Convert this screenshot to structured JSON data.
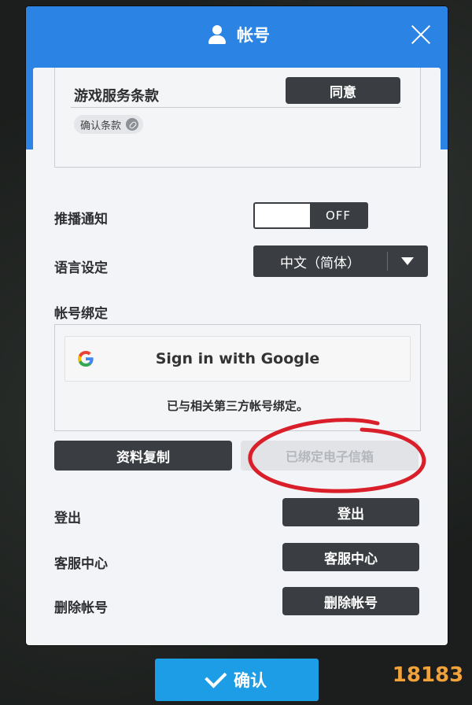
{
  "dialog": {
    "title": "帐号",
    "terms": {
      "label": "游戏服务条款",
      "agree_button": "同意",
      "confirm_link": "确认条款"
    },
    "push": {
      "label": "推播通知",
      "toggle_state": "OFF"
    },
    "language": {
      "label": "语言设定",
      "selected": "中文（简体）"
    },
    "binding": {
      "label": "帐号绑定",
      "google_button": "Sign in with Google",
      "note": "已与相关第三方帐号绑定。"
    },
    "actions": {
      "copy_data": "资料复制",
      "email_bound": "已绑定电子信箱"
    },
    "logout": {
      "label": "登出",
      "button": "登出"
    },
    "support": {
      "label": "客服中心",
      "button": "客服中心"
    },
    "delete": {
      "label": "删除帐号",
      "button": "删除帐号"
    }
  },
  "ok_button": "确认",
  "watermark": "18183",
  "colors": {
    "header_blue": "#2b83e4",
    "dark_button": "#3a3d42",
    "ok_button": "#1d9de6",
    "annotation_red": "#d9202a"
  }
}
